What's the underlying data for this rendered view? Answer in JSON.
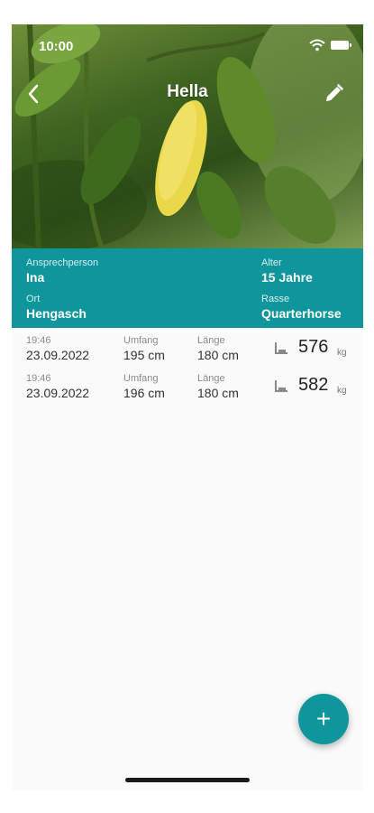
{
  "status_bar": {
    "time": "10:00"
  },
  "header": {
    "title": "Hella"
  },
  "info": {
    "contact_label": "Ansprechperson",
    "contact_value": "Ina",
    "age_label": "Alter",
    "age_value": "15 Jahre",
    "location_label": "Ort",
    "location_value": "Hengasch",
    "breed_label": "Rasse",
    "breed_value": "Quarterhorse"
  },
  "measurements": [
    {
      "time": "19:46",
      "date": "23.09.2022",
      "girth_label": "Umfang",
      "girth": "195 cm",
      "length_label": "Länge",
      "length": "180 cm",
      "weight": "576",
      "unit": "kg"
    },
    {
      "time": "19:46",
      "date": "23.09.2022",
      "girth_label": "Umfang",
      "girth": "196 cm",
      "length_label": "Länge",
      "length": "180 cm",
      "weight": "582",
      "unit": "kg"
    }
  ],
  "fab": {
    "label": "+"
  },
  "colors": {
    "accent": "#0f969c"
  }
}
